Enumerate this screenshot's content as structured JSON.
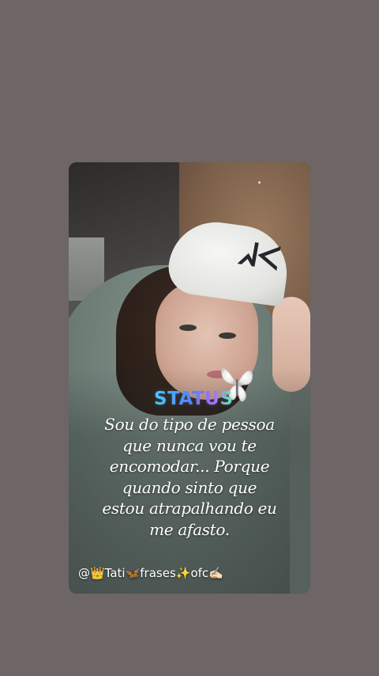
{
  "story": {
    "status_label": "STATUS",
    "quote_lines": [
      "Sou do tipo de pessoa",
      "que nunca vou te",
      "encomodar... Porque",
      "quando sinto que",
      "estou atrapalhando eu",
      "me afasto."
    ],
    "signature": "@👑Tati🦋frases✨ofc✍🏻"
  },
  "colors": {
    "background": "#6e6567",
    "text": "#ffffff",
    "status_gradient_start": "#3bd0ff",
    "status_gradient_end": "#53ff9a"
  },
  "icons": {
    "butterfly": "butterfly-icon",
    "cap_logo": "ny-cap-logo"
  }
}
